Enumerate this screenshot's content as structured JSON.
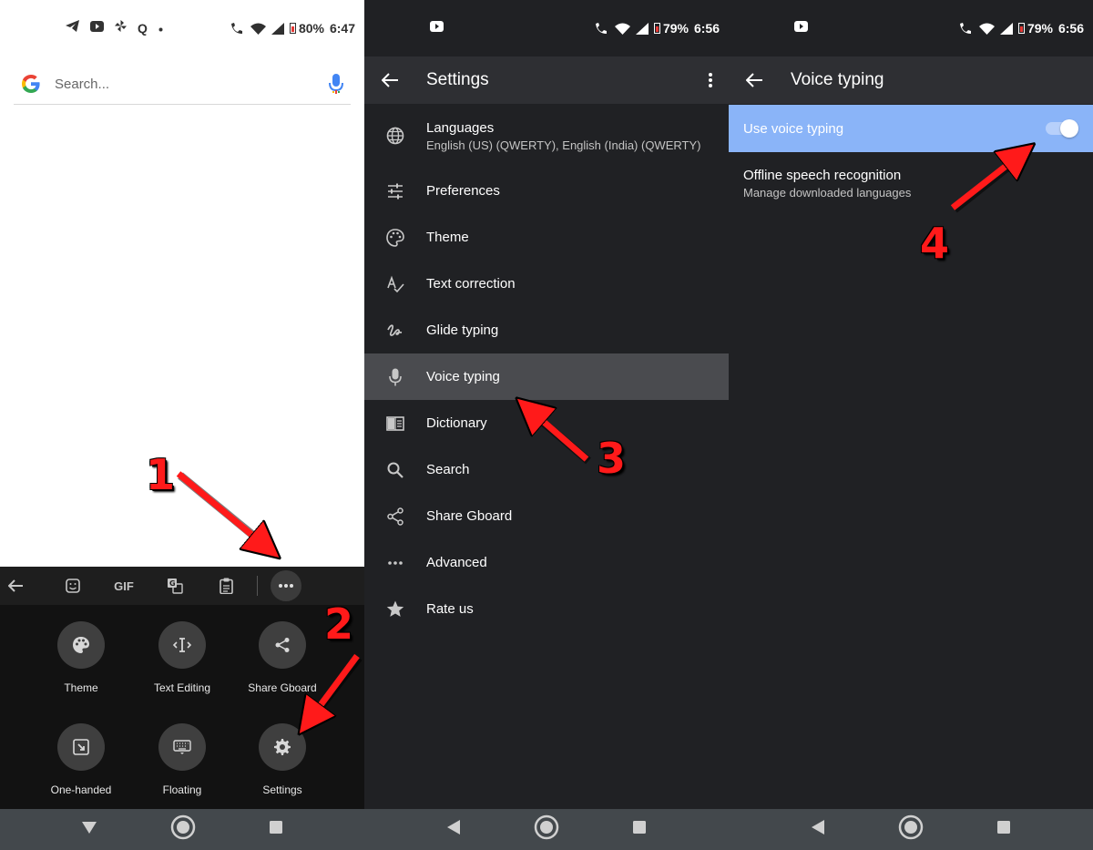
{
  "panel1": {
    "status": {
      "time": "6:47",
      "battery": "80%"
    },
    "search": {
      "placeholder": "Search..."
    },
    "keyboard_toolbar": {
      "gif_label": "GIF"
    },
    "keyboard_menu": [
      {
        "label": "Theme",
        "icon": "palette-icon"
      },
      {
        "label": "Text Editing",
        "icon": "text-cursor-icon"
      },
      {
        "label": "Share Gboard",
        "icon": "share-icon"
      },
      {
        "label": "One-handed",
        "icon": "one-handed-icon"
      },
      {
        "label": "Floating",
        "icon": "keyboard-icon"
      },
      {
        "label": "Settings",
        "icon": "gear-icon"
      }
    ]
  },
  "panel2": {
    "status": {
      "time": "6:56",
      "battery": "79%"
    },
    "title": "Settings",
    "items": [
      {
        "label": "Languages",
        "sub": "English (US) (QWERTY), English (India) (QWERTY)",
        "icon": "globe-icon"
      },
      {
        "label": "Preferences",
        "icon": "sliders-icon"
      },
      {
        "label": "Theme",
        "icon": "palette-icon"
      },
      {
        "label": "Text correction",
        "icon": "spellcheck-icon"
      },
      {
        "label": "Glide typing",
        "icon": "gesture-icon"
      },
      {
        "label": "Voice typing",
        "icon": "mic-icon",
        "selected": true
      },
      {
        "label": "Dictionary",
        "icon": "book-icon"
      },
      {
        "label": "Search",
        "icon": "search-icon"
      },
      {
        "label": "Share Gboard",
        "icon": "share-icon"
      },
      {
        "label": "Advanced",
        "icon": "more-horizontal-icon"
      },
      {
        "label": "Rate us",
        "icon": "star-icon"
      }
    ]
  },
  "panel3": {
    "status": {
      "time": "6:56",
      "battery": "79%"
    },
    "title": "Voice typing",
    "use_voice_typing": {
      "label": "Use voice typing",
      "enabled": true
    },
    "offline": {
      "label": "Offline speech recognition",
      "sub": "Manage downloaded languages"
    }
  },
  "annotations": [
    "1",
    "2",
    "3",
    "4"
  ],
  "colors": {
    "highlight": "#8ab4f8",
    "annotation": "#ff1a1a",
    "dark_bg": "#202124"
  }
}
